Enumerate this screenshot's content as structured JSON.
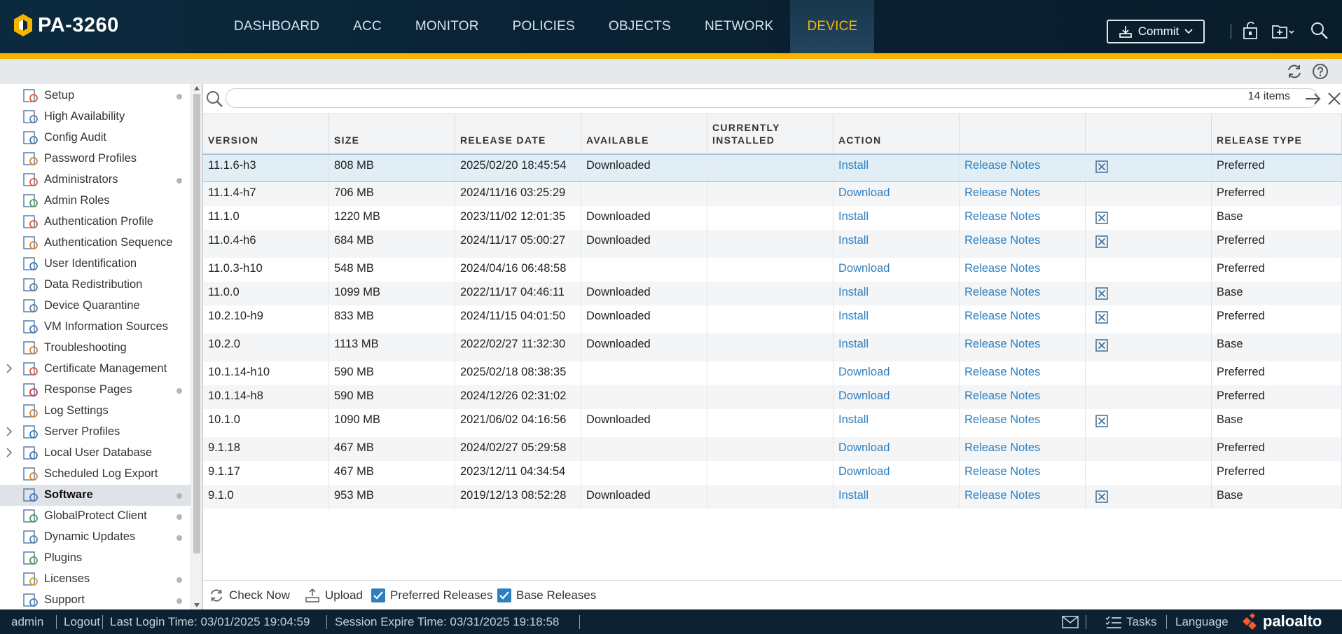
{
  "app": {
    "model": "PA-3260"
  },
  "nav": {
    "tabs": [
      {
        "label": "DASHBOARD"
      },
      {
        "label": "ACC"
      },
      {
        "label": "MONITOR"
      },
      {
        "label": "POLICIES"
      },
      {
        "label": "OBJECTS"
      },
      {
        "label": "NETWORK"
      },
      {
        "label": "DEVICE"
      }
    ],
    "active": "DEVICE",
    "commit_label": "Commit"
  },
  "sidebar": {
    "items": [
      {
        "label": "Setup",
        "icon": "setup-icon",
        "dot": true
      },
      {
        "label": "High Availability",
        "icon": "high-availability-icon",
        "dot": false
      },
      {
        "label": "Config Audit",
        "icon": "config-audit-icon",
        "dot": false
      },
      {
        "label": "Password Profiles",
        "icon": "password-profiles-icon",
        "dot": false
      },
      {
        "label": "Administrators",
        "icon": "administrators-icon",
        "dot": true
      },
      {
        "label": "Admin Roles",
        "icon": "admin-roles-icon",
        "dot": false
      },
      {
        "label": "Authentication Profile",
        "icon": "authentication-profile-icon",
        "dot": false
      },
      {
        "label": "Authentication Sequence",
        "icon": "authentication-sequence-icon",
        "dot": false
      },
      {
        "label": "User Identification",
        "icon": "user-identification-icon",
        "dot": false
      },
      {
        "label": "Data Redistribution",
        "icon": "data-redistribution-icon",
        "dot": false
      },
      {
        "label": "Device Quarantine",
        "icon": "device-quarantine-icon",
        "dot": false
      },
      {
        "label": "VM Information Sources",
        "icon": "vm-information-sources-icon",
        "dot": false
      },
      {
        "label": "Troubleshooting",
        "icon": "troubleshooting-icon",
        "dot": false
      },
      {
        "label": "Certificate Management",
        "icon": "certificate-management-icon",
        "dot": false,
        "expandable": true
      },
      {
        "label": "Response Pages",
        "icon": "response-pages-icon",
        "dot": true
      },
      {
        "label": "Log Settings",
        "icon": "log-settings-icon",
        "dot": false
      },
      {
        "label": "Server Profiles",
        "icon": "server-profiles-icon",
        "dot": false,
        "expandable": true
      },
      {
        "label": "Local User Database",
        "icon": "local-user-database-icon",
        "dot": false,
        "expandable": true
      },
      {
        "label": "Scheduled Log Export",
        "icon": "scheduled-log-export-icon",
        "dot": false
      },
      {
        "label": "Software",
        "icon": "software-icon",
        "dot": true,
        "selected": true
      },
      {
        "label": "GlobalProtect Client",
        "icon": "globalprotect-client-icon",
        "dot": true
      },
      {
        "label": "Dynamic Updates",
        "icon": "dynamic-updates-icon",
        "dot": true
      },
      {
        "label": "Plugins",
        "icon": "plugins-icon",
        "dot": false
      },
      {
        "label": "Licenses",
        "icon": "licenses-icon",
        "dot": true
      },
      {
        "label": "Support",
        "icon": "support-icon",
        "dot": true
      }
    ]
  },
  "search": {
    "value": "",
    "items_count": "14 items"
  },
  "table": {
    "headers": [
      "VERSION",
      "SIZE",
      "RELEASE DATE",
      "AVAILABLE",
      "CURRENTLY INSTALLED",
      "ACTION",
      "",
      "",
      "RELEASE TYPE"
    ],
    "rows": [
      {
        "version": "11.1.6-h3",
        "size": "808 MB",
        "date": "2025/02/20 18:45:54",
        "available": "Downloaded",
        "installed": "",
        "action": "Install",
        "notes": "Release Notes",
        "x": true,
        "type": "Preferred"
      },
      {
        "version": "11.1.4-h7",
        "size": "706 MB",
        "date": "2024/11/16 03:25:29",
        "available": "",
        "installed": "",
        "action": "Download",
        "notes": "Release Notes",
        "x": false,
        "type": "Preferred"
      },
      {
        "version": "11.1.0",
        "size": "1220 MB",
        "date": "2023/11/02 12:01:35",
        "available": "Downloaded",
        "installed": "",
        "action": "Install",
        "notes": "Release Notes",
        "x": true,
        "type": "Base"
      },
      {
        "version": "11.0.4-h6",
        "size": "684 MB",
        "date": "2024/11/17 05:00:27",
        "available": "Downloaded",
        "installed": "",
        "action": "Install",
        "notes": "Release Notes",
        "x": true,
        "type": "Preferred"
      },
      {
        "version": "11.0.3-h10",
        "size": "548 MB",
        "date": "2024/04/16 06:48:58",
        "available": "",
        "installed": "",
        "action": "Download",
        "notes": "Release Notes",
        "x": false,
        "type": "Preferred"
      },
      {
        "version": "11.0.0",
        "size": "1099 MB",
        "date": "2022/11/17 04:46:11",
        "available": "Downloaded",
        "installed": "",
        "action": "Install",
        "notes": "Release Notes",
        "x": true,
        "type": "Base"
      },
      {
        "version": "10.2.10-h9",
        "size": "833 MB",
        "date": "2024/11/15 04:01:50",
        "available": "Downloaded",
        "installed": "",
        "action": "Install",
        "notes": "Release Notes",
        "x": true,
        "type": "Preferred"
      },
      {
        "version": "10.2.0",
        "size": "1113 MB",
        "date": "2022/02/27 11:32:30",
        "available": "Downloaded",
        "installed": "",
        "action": "Install",
        "notes": "Release Notes",
        "x": true,
        "type": "Base"
      },
      {
        "version": "10.1.14-h10",
        "size": "590 MB",
        "date": "2025/02/18 08:38:35",
        "available": "",
        "installed": "",
        "action": "Download",
        "notes": "Release Notes",
        "x": false,
        "type": "Preferred"
      },
      {
        "version": "10.1.14-h8",
        "size": "590 MB",
        "date": "2024/12/26 02:31:02",
        "available": "",
        "installed": "",
        "action": "Download",
        "notes": "Release Notes",
        "x": false,
        "type": "Preferred"
      },
      {
        "version": "10.1.0",
        "size": "1090 MB",
        "date": "2021/06/02 04:16:56",
        "available": "Downloaded",
        "installed": "",
        "action": "Install",
        "notes": "Release Notes",
        "x": true,
        "type": "Base"
      },
      {
        "version": "9.1.18",
        "size": "467 MB",
        "date": "2024/02/27 05:29:58",
        "available": "",
        "installed": "",
        "action": "Download",
        "notes": "Release Notes",
        "x": false,
        "type": "Preferred"
      },
      {
        "version": "9.1.17",
        "size": "467 MB",
        "date": "2023/12/11 04:34:54",
        "available": "",
        "installed": "",
        "action": "Download",
        "notes": "Release Notes",
        "x": false,
        "type": "Preferred"
      },
      {
        "version": "9.1.0",
        "size": "953 MB",
        "date": "2019/12/13 08:52:28",
        "available": "Downloaded",
        "installed": "",
        "action": "Install",
        "notes": "Release Notes",
        "x": true,
        "type": "Base"
      }
    ]
  },
  "bottom_toolbar": {
    "check_now": "Check Now",
    "upload": "Upload",
    "preferred_releases": "Preferred Releases",
    "base_releases": "Base Releases",
    "preferred_checked": true,
    "base_checked": true
  },
  "footer": {
    "user": "admin",
    "logout": "Logout",
    "last_login": "Last Login Time: 03/01/2025 19:04:59",
    "session_expire": "Session Expire Time: 03/31/2025 19:18:58",
    "tasks": "Tasks",
    "language": "Language",
    "brand": "paloalto"
  },
  "colors": {
    "accent": "#f7b500",
    "header_bg": "#0b2a3f",
    "link": "#2f7fbf",
    "selected_row": "#e1eef6"
  }
}
